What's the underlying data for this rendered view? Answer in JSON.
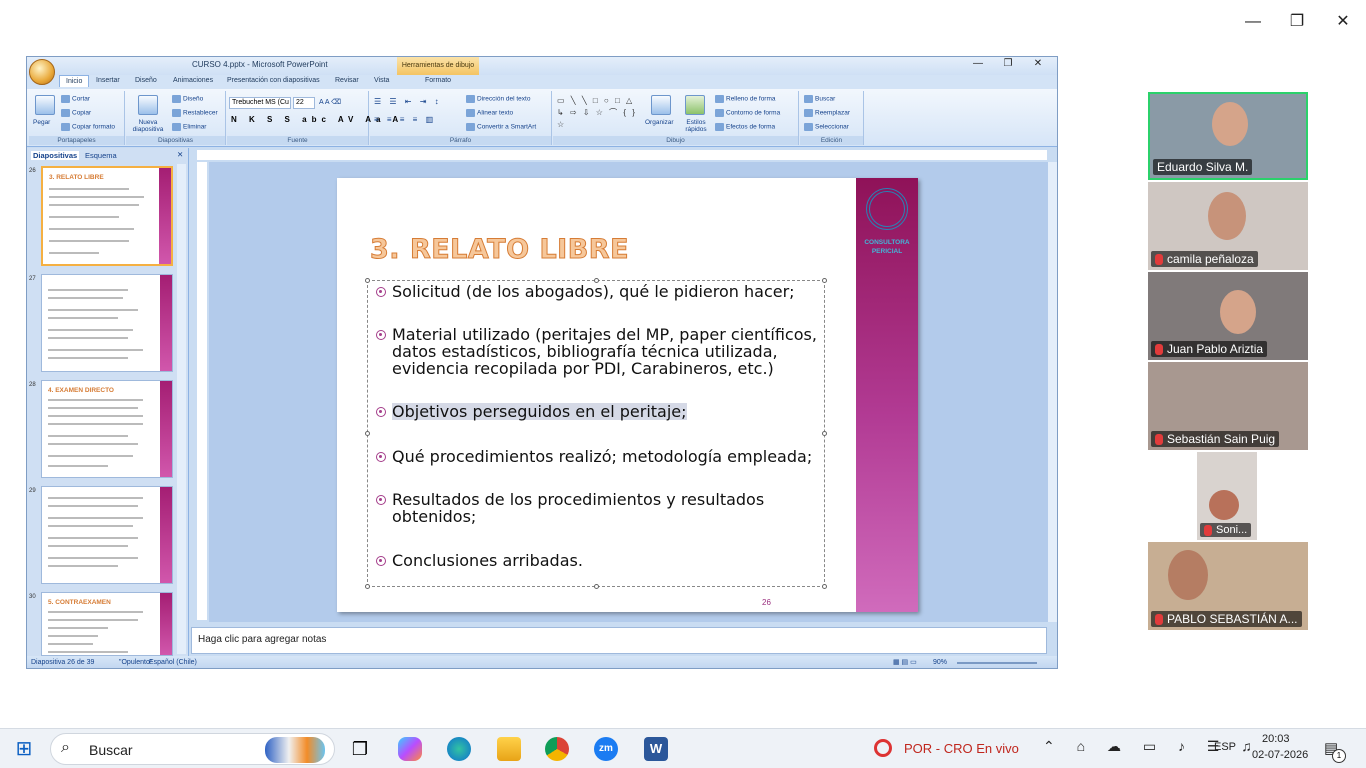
{
  "zoom_window": {
    "minimize_glyph": "—",
    "restore_glyph": "❐",
    "close_glyph": "✕"
  },
  "ppt": {
    "title": "CURSO 4.pptx - Microsoft PowerPoint",
    "contextual_tab": "Herramientas de dibujo",
    "tabs": [
      "Inicio",
      "Insertar",
      "Diseño",
      "Animaciones",
      "Presentación con diapositivas",
      "Revisar",
      "Vista",
      "Formato"
    ],
    "groups": {
      "portapapeles": {
        "label": "Portapapeles",
        "pegar": "Pegar",
        "cortar": "Cortar",
        "copiar": "Copiar",
        "copiar_formato": "Copiar formato"
      },
      "diapositivas": {
        "label": "Diapositivas",
        "nueva": "Nueva diapositiva",
        "diseno": "Diseño",
        "restablecer": "Restablecer",
        "eliminar": "Eliminar"
      },
      "fuente": {
        "label": "Fuente",
        "font": "Trebuchet MS (Cu",
        "size": "22"
      },
      "parrafo": {
        "label": "Párrafo",
        "direccion": "Dirección del texto",
        "alinear": "Alinear texto",
        "convertir": "Convertir a SmartArt"
      },
      "dibujo": {
        "label": "Dibujo",
        "organizar": "Organizar",
        "estilos": "Estilos rápidos",
        "relleno": "Relleno de forma",
        "contorno": "Contorno de forma",
        "efectos": "Efectos de forma"
      },
      "edicion": {
        "label": "Edición",
        "buscar": "Buscar",
        "reemplazar": "Reemplazar",
        "seleccionar": "Seleccionar"
      }
    },
    "left_tabs": {
      "diapositivas": "Diapositivas",
      "esquema": "Esquema"
    },
    "thumbnails": [
      {
        "num": "26",
        "title": "3. RELATO LIBRE"
      },
      {
        "num": "27",
        "title": ""
      },
      {
        "num": "28",
        "title": "4. EXAMEN DIRECTO"
      },
      {
        "num": "29",
        "title": ""
      },
      {
        "num": "30",
        "title": "5. CONTRAEXAMEN"
      }
    ],
    "slide": {
      "title": "3. RELATO LIBRE",
      "logo_text": "CONSULTORA PERICIAL",
      "bullets": [
        "Solicitud (de los abogados), qué le pidieron hacer;",
        "Material utilizado (peritajes del MP, paper científicos, datos estadísticos, bibliografía técnica utilizada, evidencia recopilada por PDI, Carabineros, etc.)",
        "Objetivos perseguidos en el peritaje;",
        "Qué procedimientos realizó; metodología empleada;",
        "Resultados de los procedimientos y resultados obtenidos;",
        "Conclusiones arribadas."
      ],
      "number": "26"
    },
    "notes_placeholder": "Haga clic para agregar notas",
    "status": {
      "slide_info": "Diapositiva 26 de 39",
      "theme": "\"Opulento\"",
      "language": "Español (Chile)",
      "zoom": "90%"
    }
  },
  "participants": [
    {
      "name": "Eduardo Silva M.",
      "muted": false,
      "active": true
    },
    {
      "name": "camila peñaloza",
      "muted": true,
      "active": false
    },
    {
      "name": "Juan Pablo Ariztia",
      "muted": true,
      "active": false
    },
    {
      "name": "Sebastián Sain Puig",
      "muted": true,
      "active": false
    },
    {
      "name": "Soni...",
      "muted": true,
      "active": false
    },
    {
      "name": "PABLO SEBASTIÁN A...",
      "muted": true,
      "active": false
    }
  ],
  "taskbar": {
    "search_placeholder": "Buscar",
    "notification": "POR - CRO En vivo",
    "lang": "ESP",
    "time": "20:03",
    "date": "02-07-2026",
    "badge": "1"
  }
}
